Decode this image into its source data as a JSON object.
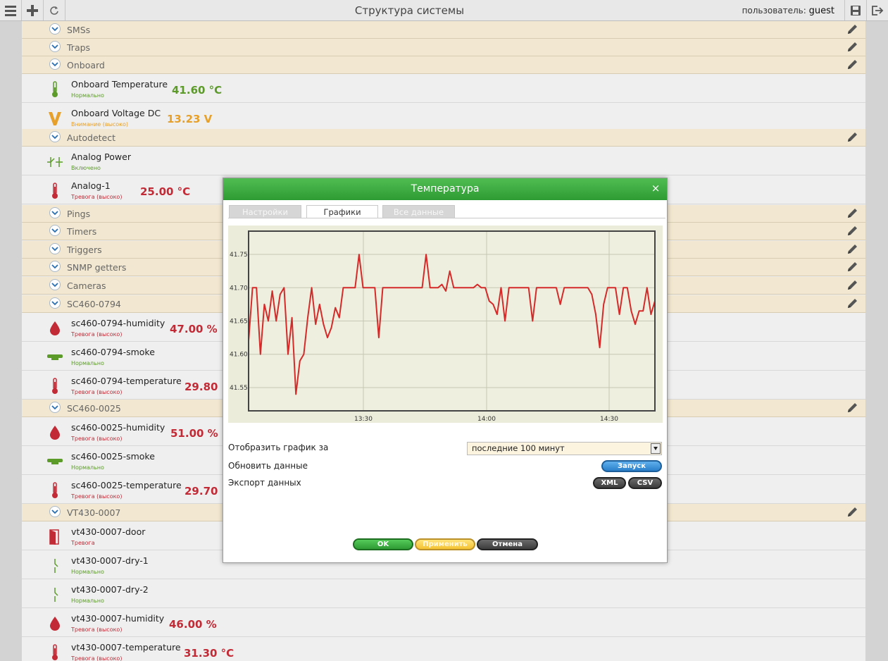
{
  "app": {
    "title": "Структура системы",
    "user_prefix": "пользователь:",
    "user_name": "guest"
  },
  "groups": [
    {
      "name": "SMSs"
    },
    {
      "name": "Traps"
    },
    {
      "name": "Onboard"
    },
    {
      "name": "Autodetect"
    },
    {
      "name": "Pings"
    },
    {
      "name": "Timers"
    },
    {
      "name": "Triggers"
    },
    {
      "name": "SNMP getters"
    },
    {
      "name": "Cameras"
    },
    {
      "name": "SC460-0794"
    },
    {
      "name": "SC460-0025"
    },
    {
      "name": "VT430-0007"
    }
  ],
  "items": [
    {
      "name": "Onboard Temperature",
      "status": "Нормально",
      "value": "41.60 °C",
      "icon": "thermometer-green-icon"
    },
    {
      "name": "Onboard Voltage DC",
      "status": "Внимание (высоко)",
      "value": "13.23 V",
      "icon": "voltage-icon"
    },
    {
      "name": "Analog Power",
      "status": "Включено",
      "value": "",
      "icon": "switch-icon"
    },
    {
      "name": "Analog-1",
      "status": "Тревога (высоко)",
      "value": "25.00 °C",
      "icon": "thermometer-red-icon"
    },
    {
      "name": "sc460-0794-humidity",
      "status": "Тревога (высоко)",
      "value": "47.00 %",
      "icon": "humidity-icon"
    },
    {
      "name": "sc460-0794-smoke",
      "status": "Нормально",
      "value": "",
      "icon": "smoke-detector-icon"
    },
    {
      "name": "sc460-0794-temperature",
      "status": "Тревога (высоко)",
      "value": "29.80 °C",
      "icon": "thermometer-red-icon"
    },
    {
      "name": "sc460-0025-humidity",
      "status": "Тревога (высоко)",
      "value": "51.00 %",
      "icon": "humidity-icon"
    },
    {
      "name": "sc460-0025-smoke",
      "status": "Нормально",
      "value": "",
      "icon": "smoke-detector-icon"
    },
    {
      "name": "sc460-0025-temperature",
      "status": "Тревога (высоко)",
      "value": "29.70 °C",
      "icon": "thermometer-red-icon"
    },
    {
      "name": "vt430-0007-door",
      "status": "Тревога",
      "value": "",
      "icon": "door-icon"
    },
    {
      "name": "vt430-0007-dry-1",
      "status": "Нормально",
      "value": "",
      "icon": "dry-contact-icon"
    },
    {
      "name": "vt430-0007-dry-2",
      "status": "Нормально",
      "value": "",
      "icon": "dry-contact-icon"
    },
    {
      "name": "vt430-0007-humidity",
      "status": "Тревога (высоко)",
      "value": "46.00 %",
      "icon": "humidity-icon"
    },
    {
      "name": "vt430-0007-temperature",
      "status": "Тревога (высоко)",
      "value": "31.30 °C",
      "icon": "thermometer-red-icon"
    }
  ],
  "modal": {
    "title": "Температура",
    "close": "×",
    "tabs": [
      "Настройки",
      "Графики",
      "Все данные"
    ],
    "period_label": "Отобразить график за",
    "period_value": "последние 100 минут",
    "refresh_label": "Обновить данные",
    "run_button": "Запуск",
    "export_label": "Экспорт данных",
    "xml_button": "XML",
    "csv_button": "CSV",
    "ok_button": "OK",
    "apply_button": "Применить",
    "cancel_button": "Отмена"
  },
  "chart_data": {
    "type": "line",
    "x_tick_labels": [
      "13:30",
      "14:00",
      "14:30"
    ],
    "y_tick_labels": [
      "41.55",
      "41.60",
      "41.65",
      "41.70",
      "41.75"
    ],
    "ylim": [
      41.515,
      41.785
    ],
    "line_color": "#d42a2a",
    "series": [
      {
        "values": [
          41.62,
          41.7,
          41.7,
          41.6,
          41.675,
          41.65,
          41.695,
          41.65,
          41.69,
          41.7,
          41.6,
          41.655,
          41.54,
          41.59,
          41.6,
          41.655,
          41.7,
          41.645,
          41.675,
          41.645,
          41.625,
          41.64,
          41.67,
          41.655,
          41.7,
          41.7,
          41.7,
          41.7,
          41.75,
          41.7,
          41.7,
          41.7,
          41.7,
          41.625,
          41.7,
          41.7,
          41.7,
          41.7,
          41.7,
          41.7,
          41.7,
          41.7,
          41.7,
          41.7,
          41.7,
          41.75,
          41.7,
          41.7,
          41.7,
          41.705,
          41.695,
          41.725,
          41.7,
          41.7,
          41.7,
          41.7,
          41.7,
          41.7,
          41.705,
          41.7,
          41.7,
          41.68,
          41.675,
          41.66,
          41.7,
          41.65,
          41.7,
          41.7,
          41.7,
          41.7,
          41.7,
          41.7,
          41.65,
          41.7,
          41.7,
          41.7,
          41.7,
          41.7,
          41.7,
          41.675,
          41.7,
          41.7,
          41.7,
          41.7,
          41.7,
          41.7,
          41.7,
          41.69,
          41.66,
          41.61,
          41.675,
          41.7,
          41.7,
          41.7,
          41.66,
          41.7,
          41.7,
          41.665,
          41.645,
          41.665,
          41.665,
          41.7,
          41.66,
          41.68
        ]
      }
    ]
  }
}
